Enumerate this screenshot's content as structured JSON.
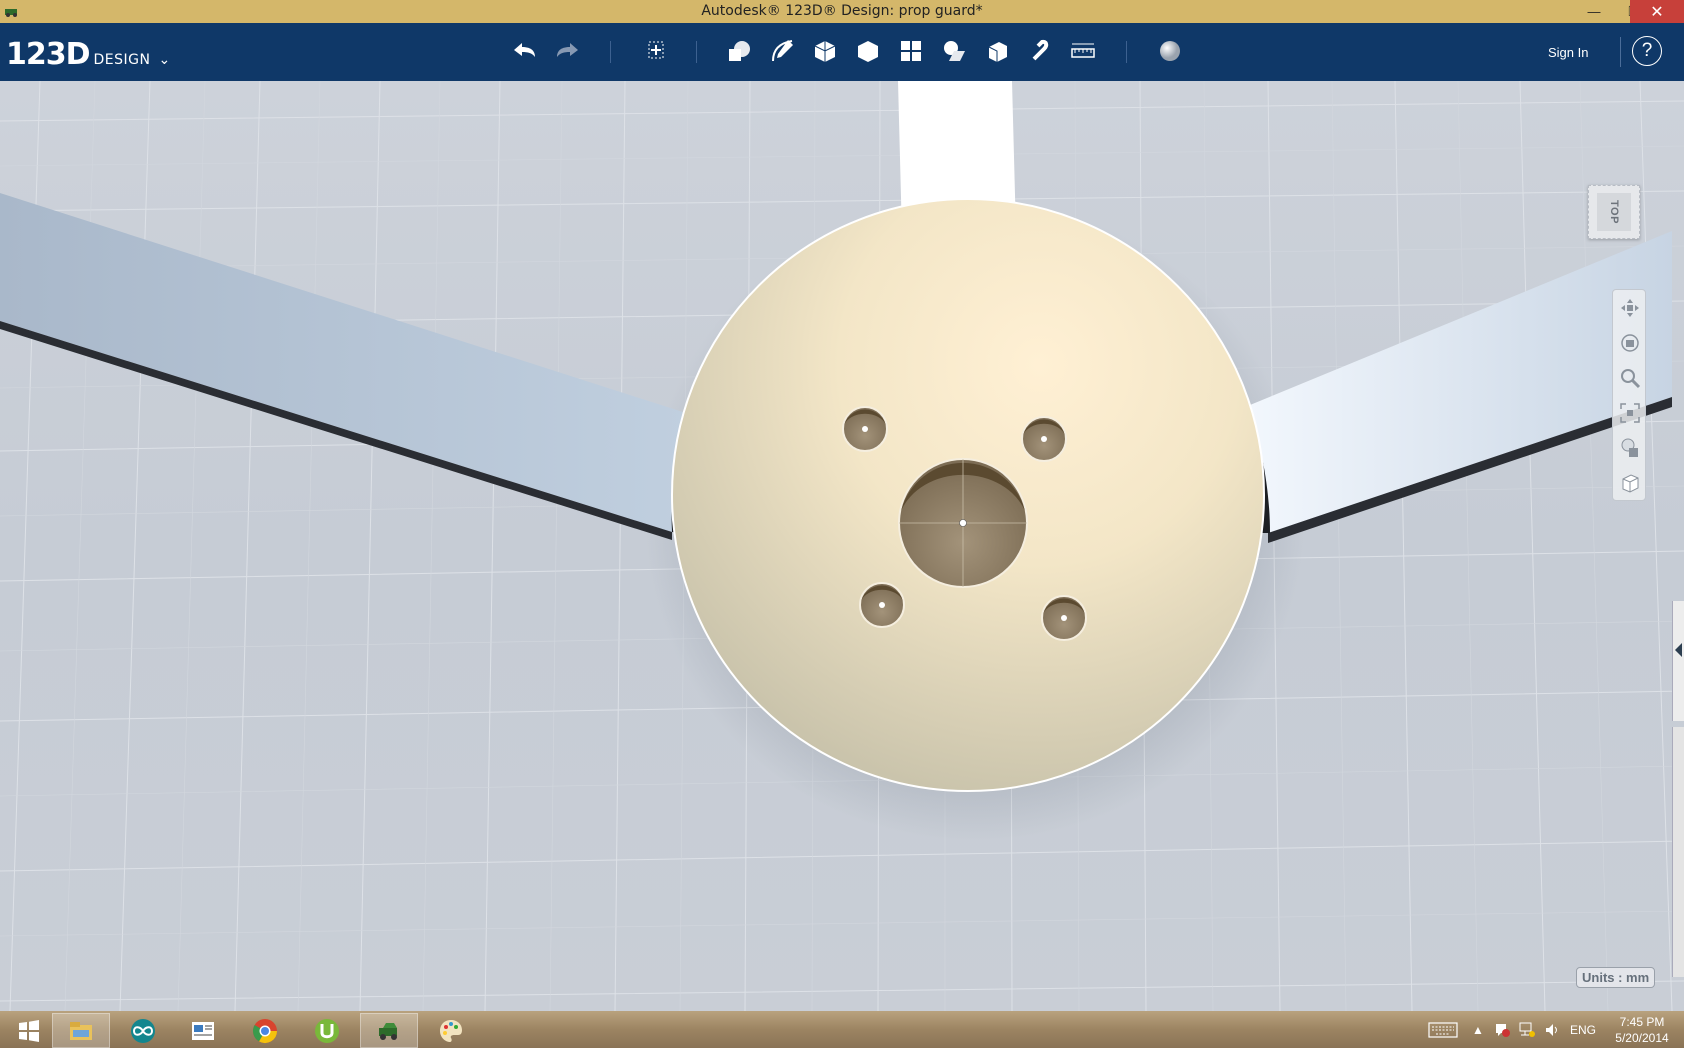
{
  "window": {
    "title": "Autodesk® 123D® Design: prop guard*",
    "minimize_glyph": "—",
    "maximize_glyph": "❐",
    "close_glyph": "✕"
  },
  "toolbar": {
    "logo_number": "123D",
    "logo_word": "DESIGN",
    "logo_chevron": "⌄",
    "tools": [
      "undo-icon",
      "redo-icon",
      "transform-icon",
      "primitives-icon",
      "sketch-icon",
      "construct-icon",
      "modify-icon",
      "pattern-icon",
      "grouping-icon",
      "combine-icon",
      "snap-icon",
      "measure-icon",
      "material-icon"
    ],
    "sign_in": "Sign In",
    "help": "?"
  },
  "viewport": {
    "viewcube_label": "TOP",
    "units_label": "Units : mm",
    "nav_tools": [
      "pan-icon",
      "orbit-icon",
      "zoom-icon",
      "fit-icon",
      "visual-style-icon",
      "ortho-icon"
    ],
    "model_colors": {
      "hub_light": "#fdeccd",
      "hub_dark": "#c9c4ae",
      "arm": "#b6c6d8",
      "hole": "#9a8a6e"
    }
  },
  "taskbar": {
    "apps": [
      "windows-start-icon",
      "file-explorer-icon",
      "arduino-icon",
      "news-reader-icon",
      "chrome-icon",
      "utorrent-icon",
      "123d-design-icon",
      "paint-icon"
    ],
    "language": "ENG",
    "time": "7:45 PM",
    "date": "5/20/2014"
  }
}
